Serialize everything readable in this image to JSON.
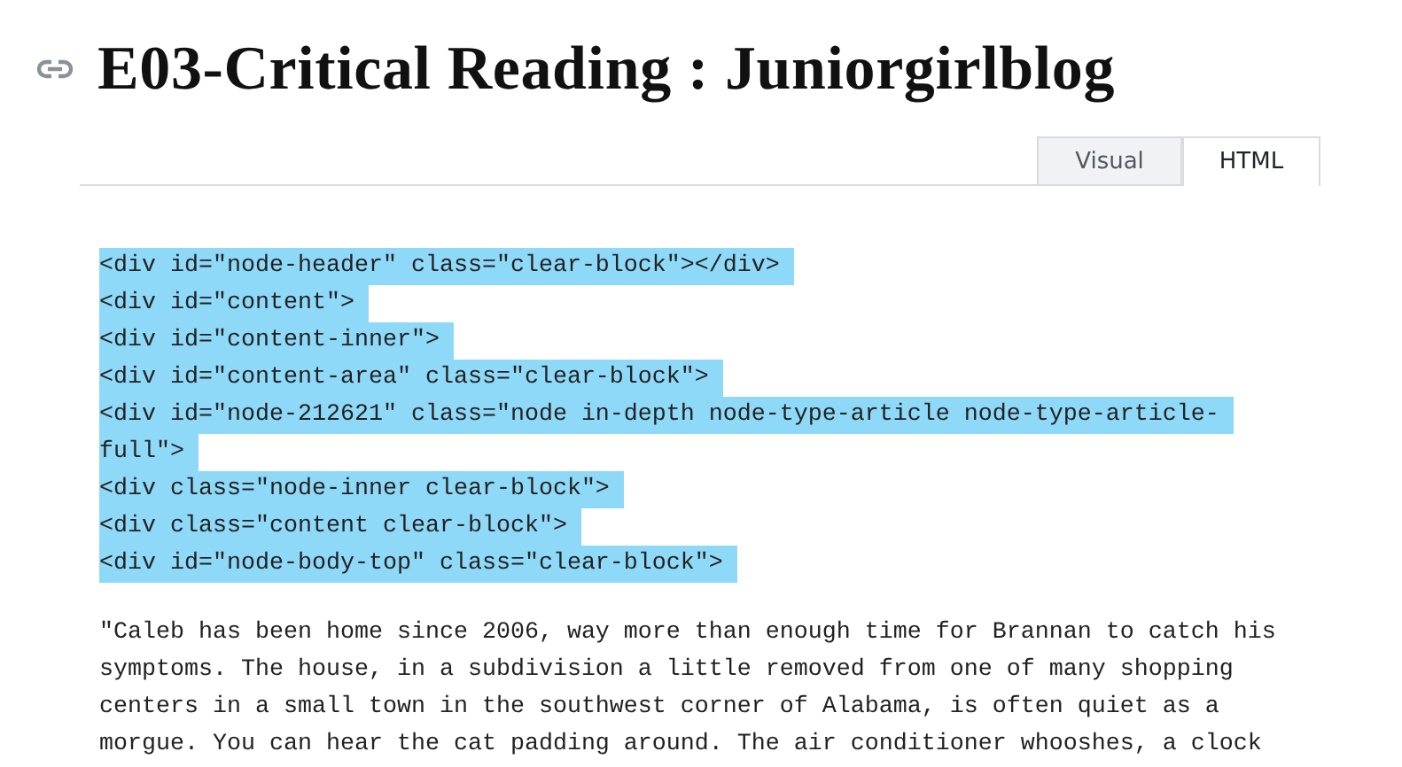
{
  "title": "E03-Critical Reading : Juniorgirlblog",
  "tabs": [
    {
      "label": "Visual",
      "selected": false
    },
    {
      "label": "HTML",
      "selected": true
    }
  ],
  "code_lines": [
    {
      "text": "<div id=\"node-header\" class=\"clear-block\"></div>",
      "selected": true
    },
    {
      "text": "<div id=\"content\">",
      "selected": true
    },
    {
      "text": "<div id=\"content-inner\">",
      "selected": true
    },
    {
      "text": "<div id=\"content-area\" class=\"clear-block\">",
      "selected": true
    },
    {
      "text": "<div id=\"node-212621\" class=\"node in-depth node-type-article node-type-article-",
      "selected": true
    },
    {
      "text": "full\">",
      "selected": true
    },
    {
      "text": "<div class=\"node-inner clear-block\">",
      "selected": true
    },
    {
      "text": "<div class=\"content clear-block\">",
      "selected": true
    },
    {
      "text": "<div id=\"node-body-top\" class=\"clear-block\">",
      "selected": true
    }
  ],
  "text_lines": [
    {
      "text": "\"Caleb has been home since 2006, way more than enough time for Brannan to catch his",
      "selected": false
    },
    {
      "text": "symptoms. The house, in a subdivision a little removed from one of many shopping",
      "selected": false
    },
    {
      "text": "centers in a small town in the southwest corner of Alabama, is often quiet as a",
      "selected": false
    },
    {
      "text": "morgue. You can hear the cat padding around. The air conditioner whooshes, a clock",
      "selected": false
    }
  ]
}
